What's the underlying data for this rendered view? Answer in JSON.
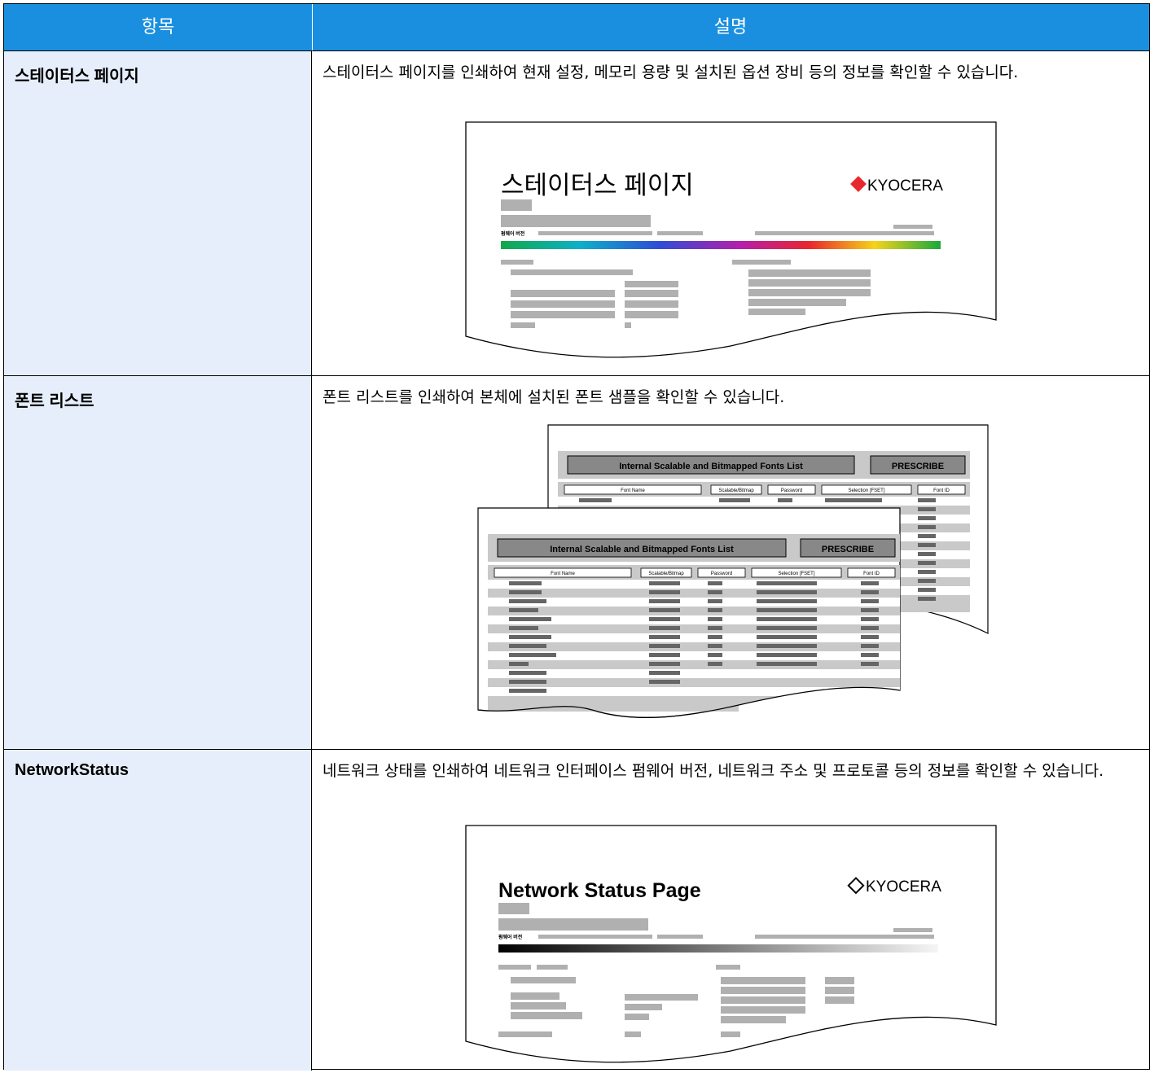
{
  "table": {
    "header": {
      "col1": "항목",
      "col2": "설명"
    },
    "rows": [
      {
        "item": "스테이터스 페이지",
        "description": "스테이터스 페이지를 인쇄하여 현재 설정, 메모리 용량 및 설치된 옵션 장비 등의 정보를 확인할 수 있습니다.",
        "figure": {
          "title": "스테이터스 페이지",
          "brand": "KYOCERA",
          "sub_label": "펌웨어 버전"
        }
      },
      {
        "item": "폰트 리스트",
        "description": "폰트 리스트를 인쇄하여 본체에 설치된 폰트 샘플을 확인할 수 있습니다.",
        "figure": {
          "list_title": "Internal Scalable and Bitmapped Fonts List",
          "prescribe": "PRESCRIBE",
          "columns": [
            "Font Name",
            "Scalable/Bitmap",
            "Password",
            "Selection     [FSET]",
            "Font ID"
          ]
        }
      },
      {
        "item": "NetworkStatus",
        "description": "네트워크 상태를 인쇄하여 네트워크 인터페이스 펌웨어 버전, 네트워크 주소 및 프로토콜 등의 정보를 확인할 수 있습니다.",
        "figure": {
          "title": "Network Status Page",
          "brand": "KYOCERA",
          "sub_label": "펌웨어 버전"
        }
      }
    ]
  },
  "colors": {
    "header_bg": "#1a8fe0",
    "left_col_bg": "#e6eefc",
    "brand_red": "#e8262d"
  }
}
